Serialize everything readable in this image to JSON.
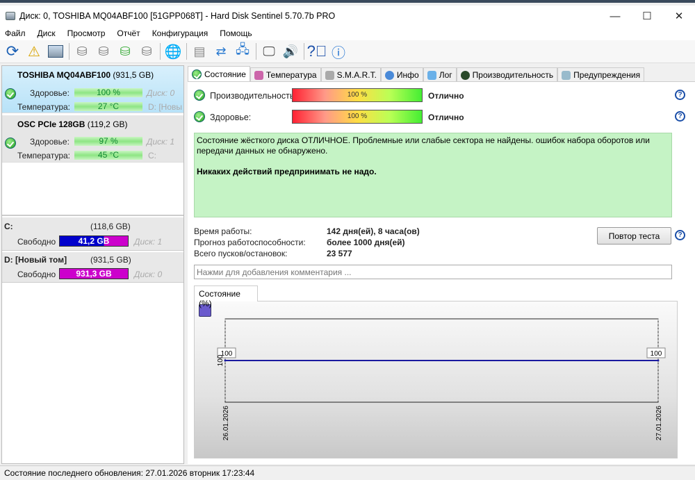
{
  "window": {
    "title": "Диск: 0, TOSHIBA MQ04ABF100 [51GPP068T]  -  Hard Disk Sentinel 5.70.7b PRO",
    "minimize": "—",
    "maximize": "☐",
    "close": "✕"
  },
  "menu": [
    "Файл",
    "Диск",
    "Просмотр",
    "Отчёт",
    "Конфигурация",
    "Помощь"
  ],
  "disks": [
    {
      "name": "TOSHIBA MQ04ABF100",
      "size": "(931,5 GB)",
      "health_label": "Здоровье:",
      "health": "100 %",
      "temp_label": "Температура:",
      "temp": "27 °C",
      "disk": "Диск: 0",
      "volume": "D: [Новы"
    },
    {
      "name": "OSC PCIe 128GB",
      "size": "(119,2 GB)",
      "health_label": "Здоровье:",
      "health": "97 %",
      "temp_label": "Температура:",
      "temp": "45 °C",
      "disk": "Диск: 1",
      "volume": "C:"
    }
  ],
  "volumes": [
    {
      "name": "C:",
      "size": "(118,6 GB)",
      "free_label": "Свободно",
      "free": "41,2 GB",
      "free_fraction": 0.35,
      "disk": "Диск: 1"
    },
    {
      "name": "D: [Новый том]",
      "size": "(931,5 GB)",
      "free_label": "Свободно",
      "free": "931,3 GB",
      "free_fraction": 1.0,
      "disk": "Диск: 0"
    }
  ],
  "tabs": [
    "Состояние",
    "Температура",
    "S.M.A.R.T.",
    "Инфо",
    "Лог",
    "Производительность",
    "Предупреждения"
  ],
  "status": {
    "perf_label": "Производительность",
    "perf_value": "100 %",
    "perf_rating": "Отлично",
    "health_label": "Здоровье:",
    "health_value": "100 %",
    "health_rating": "Отлично",
    "help": "?",
    "message": "Состояние жёсткого диска ОТЛИЧНОЕ. Проблемные или слабые сектора не найдены. ошибок набора оборотов или передачи данных не обнаружено.",
    "action": "Никаких действий предпринимать не надо.",
    "uptime_label": "Время работы:",
    "uptime": "142 дня(ей), 8 часа(ов)",
    "forecast_label": "Прогноз работоспособности:",
    "forecast": "более 1000 дня(ей)",
    "starts_label": "Всего пусков/остановок:",
    "starts": "23 577",
    "retest": "Повтор теста",
    "comment_placeholder": "Нажми для добавления комментария ..."
  },
  "chart_data": {
    "type": "line",
    "title": "Состояние (%)",
    "x": [
      "26.01.2026",
      "27.01.2026"
    ],
    "values": [
      100,
      100
    ],
    "point_labels": [
      "100",
      "100"
    ],
    "ytick": "100",
    "ylim": [
      0,
      200
    ],
    "color": "#1a1aa0"
  },
  "statusbar": "Состояние последнего обновления: 27.01.2026 вторник 17:23:44"
}
